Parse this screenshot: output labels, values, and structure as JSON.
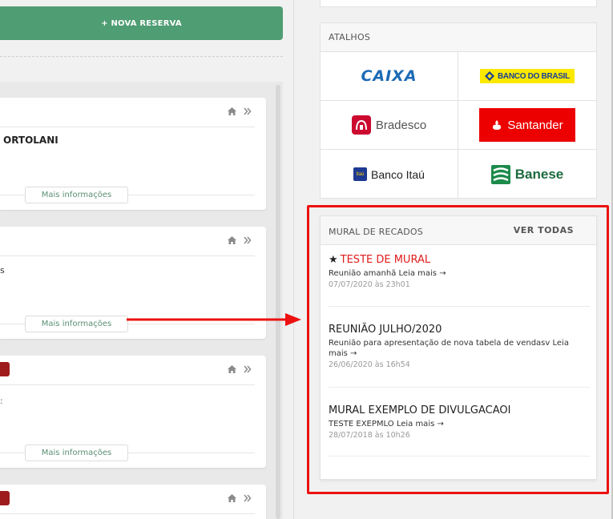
{
  "actions": {
    "new_reservation": "+ NOVA RESERVA"
  },
  "cards": [
    {
      "title": "ORTOLANI",
      "more": "Mais informações"
    },
    {
      "subtitle": "s",
      "more": "Mais informações"
    },
    {
      "subtitle": ":",
      "more": "Mais informações"
    },
    {}
  ],
  "shortcuts": {
    "title": "ATALHOS",
    "banks": {
      "caixa": "CAIXA",
      "bb": "BANCO DO BRASIL",
      "bradesco": "Bradesco",
      "santander": "Santander",
      "itau": "Banco Itaú",
      "itau_mark": "Itaú",
      "banese": "Banese"
    }
  },
  "mural": {
    "title": "MURAL DE RECADOS",
    "view_all": "VER TODAS",
    "posts": [
      {
        "title": "TESTE DE MURAL",
        "body": "Reunião amanhã",
        "read_more": "Leia mais →",
        "date": "07/07/2020 às 23h01"
      },
      {
        "title": "REUNIÃO JULHO/2020",
        "body": "Reunião para apresentação de nova tabela de vendasv",
        "read_more": "Leia mais →",
        "date": "26/06/2020 às 16h54"
      },
      {
        "title": "MURAL EXEMPLO DE DIVULGACAOI",
        "body": "TESTE EXEPMLO",
        "read_more": "Leia mais →",
        "date": "28/07/2018 às 10h26"
      }
    ]
  },
  "colors": {
    "primary_green": "#4f9d72",
    "highlight_red": "#ec1111",
    "featured_red": "#e01b1b"
  }
}
